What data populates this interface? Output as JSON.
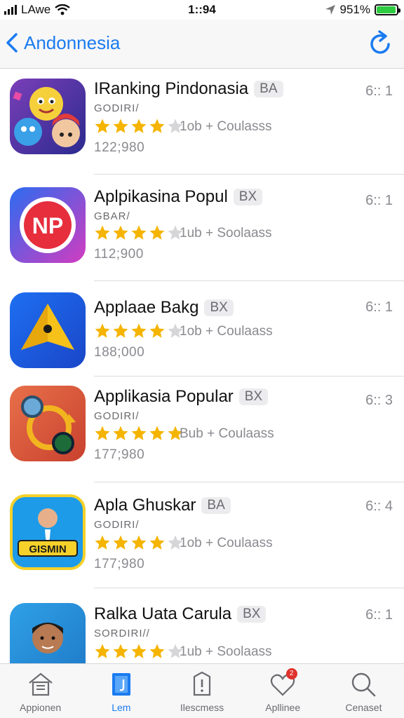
{
  "status": {
    "carrier": "LAwe",
    "time": "1::94",
    "battery_text": "951%",
    "battery_level": 0.95,
    "battery_color": "#2ecc40"
  },
  "nav": {
    "back_label": "Andonnesia",
    "back_icon": "chevron-left-icon",
    "refresh_icon": "refresh-icon",
    "accent": "#1a7bf0"
  },
  "apps": [
    {
      "name": "IRanking Pindonasia",
      "badge": "BA",
      "developer": "GODIRI/",
      "rating": 4,
      "category": "1ob + Coulasss",
      "count": "122;980",
      "rank": "6:: 1",
      "icon": "monster-characters-icon"
    },
    {
      "name": "Aplpikasina Popul",
      "badge": "BX",
      "developer": "GBAR/",
      "rating": 4,
      "category": "1ub + Soolaass",
      "count": "112;900",
      "rank": "6:: 1",
      "icon": "np-logo-icon",
      "icon_text": "NP"
    },
    {
      "name": "Applaae Bakg",
      "badge": "BX",
      "developer": "",
      "rating": 4,
      "category": "1ob + Coulaass",
      "count": "188;000",
      "rank": "6:: 1",
      "icon": "yellow-arrow-icon"
    },
    {
      "name": "Applikasia Popular",
      "badge": "BX",
      "developer": "GODIRI/",
      "rating": 5,
      "category": "Bub + Coulaass",
      "count": "177;980",
      "rank": "6:: 3",
      "icon": "puzzle-circles-icon"
    },
    {
      "name": "Apla Ghuskar",
      "badge": "BA",
      "developer": "GODIRI/",
      "rating": 4,
      "category": "1ob + Coulaass",
      "count": "177;980",
      "rank": "6:: 4",
      "icon": "presenter-game-icon",
      "icon_text": "GISMIN"
    },
    {
      "name": "Ralka Uata Carula",
      "badge": "BX",
      "developer": "SORDIRI//",
      "rating": 4,
      "category": "1ub + Soolaass",
      "count": "",
      "rank": "6:: 1",
      "icon": "person-portrait-icon"
    }
  ],
  "star_color": "#f5b400",
  "star_empty_color": "#d6d6d8",
  "tabs": [
    {
      "label": "Appionen",
      "icon": "home-icon",
      "active": false
    },
    {
      "label": "Lem",
      "icon": "book-icon",
      "active": true
    },
    {
      "label": "Ilescmess",
      "icon": "alert-doc-icon",
      "active": false
    },
    {
      "label": "Apllinee",
      "icon": "heart-icon",
      "active": false,
      "badge": "2"
    },
    {
      "label": "Cenaset",
      "icon": "search-icon",
      "active": false
    }
  ]
}
